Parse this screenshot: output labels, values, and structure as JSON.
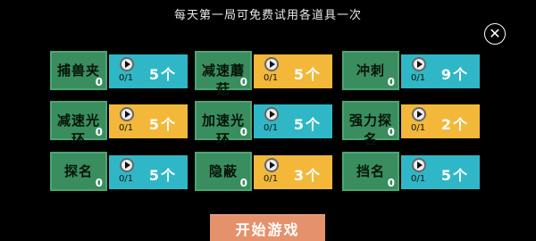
{
  "header": {
    "notice": "每天第一局可免费试用各道具一次"
  },
  "close": {
    "glyph": "✕",
    "icon": "close-icon"
  },
  "items": [
    {
      "name": "捕兽夹",
      "owned": "0",
      "usage": "0/1",
      "count": "5个",
      "color": "teal"
    },
    {
      "name": "减速蘑菇",
      "owned": "0",
      "usage": "0/1",
      "count": "5个",
      "color": "gold"
    },
    {
      "name": "冲刺",
      "owned": "0",
      "usage": "0/1",
      "count": "9个",
      "color": "teal"
    },
    {
      "name": "减速光环",
      "owned": "0",
      "usage": "0/1",
      "count": "5个",
      "color": "gold"
    },
    {
      "name": "加速光环",
      "owned": "0",
      "usage": "0/1",
      "count": "5个",
      "color": "teal"
    },
    {
      "name": "强力探名",
      "owned": "0",
      "usage": "0/1",
      "count": "2个",
      "color": "gold"
    },
    {
      "name": "探名",
      "owned": "0",
      "usage": "0/1",
      "count": "5个",
      "color": "teal"
    },
    {
      "name": "隐蔽",
      "owned": "0",
      "usage": "0/1",
      "count": "3个",
      "color": "gold"
    },
    {
      "name": "挡名",
      "owned": "0",
      "usage": "0/1",
      "count": "5个",
      "color": "teal"
    }
  ],
  "colors": {
    "teal": "#2fb7c7",
    "gold": "#f3b83a",
    "tile_green": "#3a8d5f",
    "start_button": "#e4916c"
  },
  "start_button": {
    "label": "开始游戏"
  }
}
